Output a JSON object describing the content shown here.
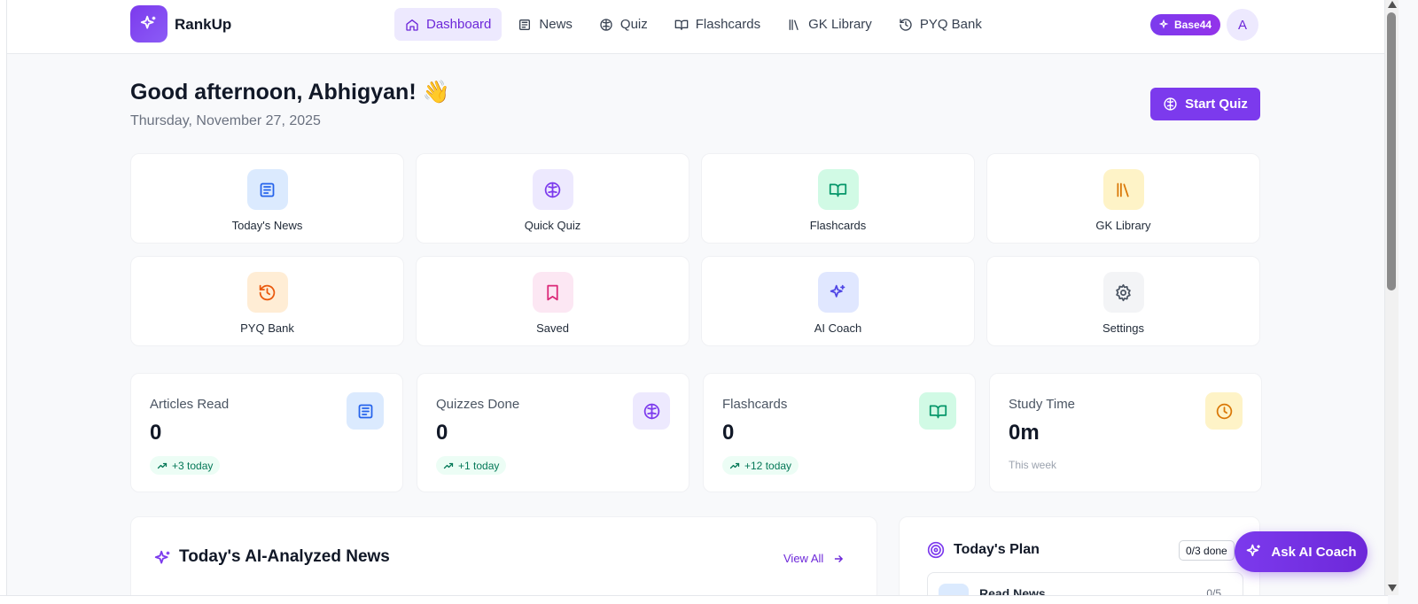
{
  "header": {
    "brand": "RankUp",
    "nav": [
      {
        "label": "Dashboard",
        "icon": "home-icon"
      },
      {
        "label": "News",
        "icon": "newspaper-icon"
      },
      {
        "label": "Quiz",
        "icon": "brain-icon"
      },
      {
        "label": "Flashcards",
        "icon": "book-open-icon"
      },
      {
        "label": "GK Library",
        "icon": "library-icon"
      },
      {
        "label": "PYQ Bank",
        "icon": "history-icon"
      }
    ],
    "active_nav": "Dashboard",
    "plan_badge": "Base44",
    "avatar_initial": "A"
  },
  "greeting": {
    "title": "Good afternoon, Abhigyan! 👋",
    "date": "Thursday, November 27, 2025",
    "start_quiz_label": "Start Quiz"
  },
  "quick_actions": [
    {
      "label": "Today's News",
      "icon": "newspaper-icon",
      "color": "#2563eb",
      "bg": "#dbeafe"
    },
    {
      "label": "Quick Quiz",
      "icon": "brain-icon",
      "color": "#7c3aed",
      "bg": "#ede9fe"
    },
    {
      "label": "Flashcards",
      "icon": "book-open-icon",
      "color": "#059669",
      "bg": "#d1fae5"
    },
    {
      "label": "GK Library",
      "icon": "library-icon",
      "color": "#d97706",
      "bg": "#fef3c7"
    },
    {
      "label": "PYQ Bank",
      "icon": "history-icon",
      "color": "#ea580c",
      "bg": "#ffedd5"
    },
    {
      "label": "Saved",
      "icon": "bookmark-icon",
      "color": "#db2777",
      "bg": "#fce7f3"
    },
    {
      "label": "AI Coach",
      "icon": "sparkles-icon",
      "color": "#4f46e5",
      "bg": "#e0e7ff"
    },
    {
      "label": "Settings",
      "icon": "gear-icon",
      "color": "#4b5563",
      "bg": "#f3f4f6"
    }
  ],
  "stats": [
    {
      "label": "Articles Read",
      "value": "0",
      "delta": "+3 today",
      "icon": "newspaper-icon",
      "color": "#2563eb",
      "bg": "#dbeafe"
    },
    {
      "label": "Quizzes Done",
      "value": "0",
      "delta": "+1 today",
      "icon": "brain-icon",
      "color": "#7c3aed",
      "bg": "#ede9fe"
    },
    {
      "label": "Flashcards",
      "value": "0",
      "delta": "+12 today",
      "icon": "book-open-icon",
      "color": "#059669",
      "bg": "#d1fae5"
    },
    {
      "label": "Study Time",
      "value": "0m",
      "sub": "This week",
      "icon": "clock-icon",
      "color": "#d97706",
      "bg": "#fef3c7"
    }
  ],
  "news_panel": {
    "title": "Today's AI-Analyzed News",
    "view_all": "View All"
  },
  "plan_panel": {
    "title": "Today's Plan",
    "count": "0/3 done",
    "row_label": "Read News",
    "row_count": "0/5"
  },
  "ask_coach_label": "Ask AI Coach"
}
